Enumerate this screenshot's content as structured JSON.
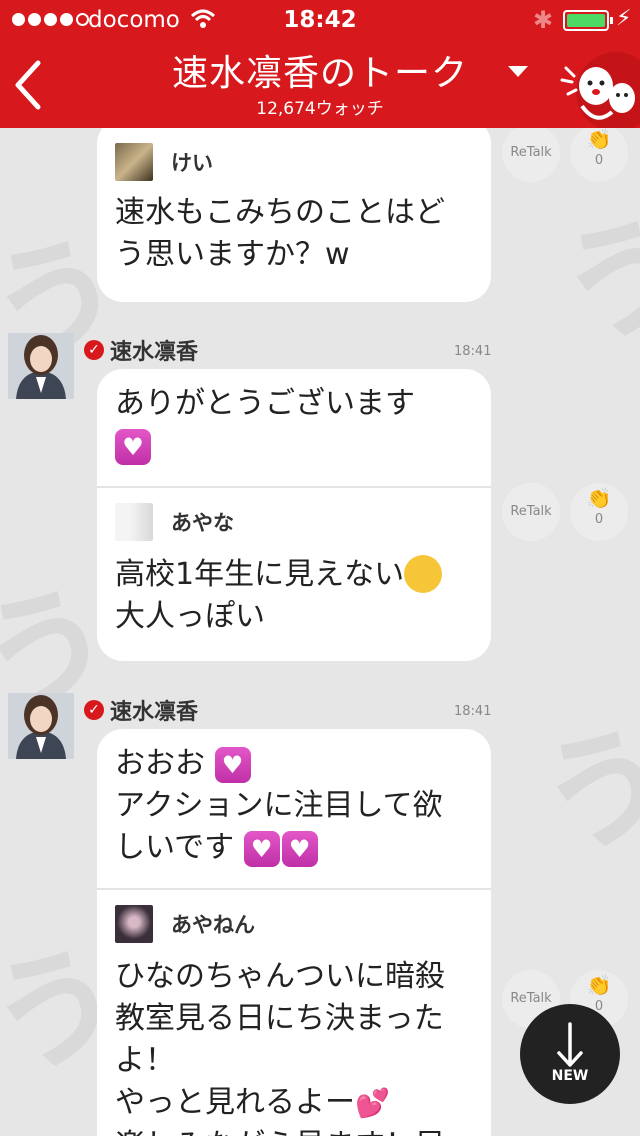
{
  "status_bar": {
    "carrier": "docomo",
    "time": "18:42"
  },
  "header": {
    "title": "速水凛香のトーク",
    "watch_count": "12,674ウォッチ"
  },
  "messages": [
    {
      "quote": {
        "user": "けい",
        "text_lines": [
          "速水もこみちのことはど",
          "う思いますか？w"
        ]
      },
      "retalk_label": "ReTalk",
      "clap_count": "0"
    },
    {
      "sender": "速水凛香",
      "time": "18:41",
      "reply_lines": [
        "ありがとうございます"
      ],
      "quote": {
        "user": "あやな",
        "text_lines": [
          "高校1年生に見えない",
          "大人っぽい"
        ]
      },
      "retalk_label": "ReTalk",
      "clap_count": "0"
    },
    {
      "sender": "速水凛香",
      "time": "18:41",
      "reply_lines": [
        "おおお",
        "アクションに注目して欲",
        "しいです"
      ],
      "quote": {
        "user": "あやねん",
        "text_lines": [
          "ひなのちゃんついに暗殺",
          "教室見る日にち決まった",
          "よ！",
          "やっと見れるよー",
          "楽しみながら見ます！早"
        ]
      },
      "retalk_label": "ReTalk",
      "clap_count": "0"
    }
  ],
  "new_button": {
    "label": "NEW"
  },
  "colors": {
    "brand_red": "#d7191d",
    "background": "#e6e6e6",
    "bubble": "#ffffff",
    "heart_emoji": "#d63fba"
  }
}
